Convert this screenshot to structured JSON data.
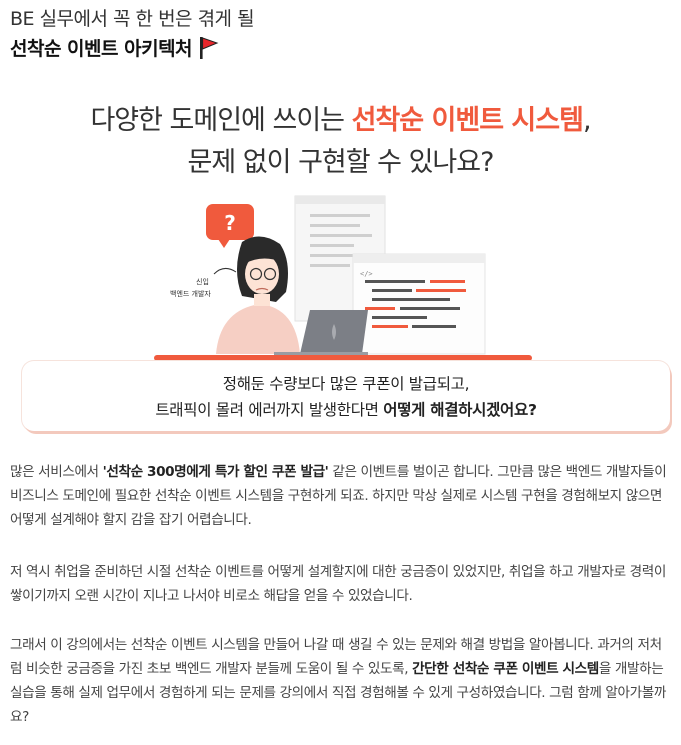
{
  "header": {
    "subtitle": "BE 실무에서 꼭 한 번은 겪게 될",
    "title": "선착순 이벤트 아키텍처",
    "flag_icon": "red-flag-icon"
  },
  "hero": {
    "line1_prefix": "다양한 도메인에 쓰이는 ",
    "line1_highlight": "선착순 이벤트 시스템",
    "line1_suffix": ",",
    "line2": "문제 없이 구현할 수 있나요?",
    "accent_color": "#f05a3d"
  },
  "illustration": {
    "question_mark": "?",
    "code_tag": "</>",
    "handwritten_label_line1": "신입",
    "handwritten_label_line2": "백엔드 개발자"
  },
  "callout": {
    "line1": "정해둔 수량보다 많은 쿠폰이 발급되고,",
    "line2_prefix": "트래픽이 몰려 에러까지 발생한다면 ",
    "line2_bold": "어떻게 해결하시겠어요?"
  },
  "body": {
    "p1_part1": "많은 서비스에서 ",
    "p1_bold": "'선착순 300명에게 특가 할인 쿠폰 발급'",
    "p1_part2": " 같은 이벤트를 벌이곤 합니다. 그만큼 많은 백엔드 개발자들이 비즈니스 도메인에 필요한 선착순 이벤트 시스템을 구현하게 되죠. 하지만 막상 실제로 시스템 구현을 경험해보지 않으면 어떻게 설계해야 할지 감을 잡기 어렵습니다.",
    "p2": "저 역시 취업을 준비하던 시절 선착순 이벤트를 어떻게 설계할지에 대한 궁금증이 있었지만, 취업을 하고 개발자로 경력이 쌓이기까지 오랜 시간이 지나고 나서야 비로소 해답을 얻을 수 있었습니다.",
    "p3_part1": "그래서 이 강의에서는 선착순 이벤트 시스템을 만들어 나갈 때 생길 수 있는 문제와 해결 방법을 알아봅니다. 과거의 저처럼 비슷한 궁금증을 가진 초보 백엔드 개발자 분들께 도움이 될 수 있도록, ",
    "p3_bold": "간단한 선착순 쿠폰 이벤트 시스템",
    "p3_part2": "을 개발하는 실습을 통해 실제 업무에서 경험하게 되는 문제를 강의에서 직접 경험해볼 수 있게 구성하였습니다. 그럼 함께 알아가볼까요?"
  }
}
